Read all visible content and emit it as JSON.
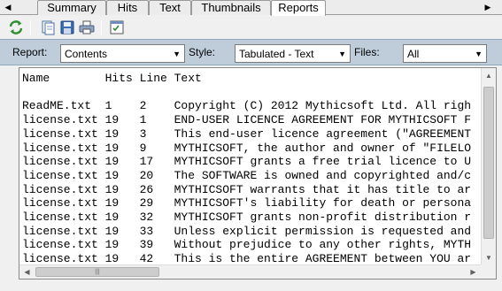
{
  "tabs": {
    "scroll_left": "◀",
    "scroll_right": "▶",
    "items": [
      {
        "label": "Summary"
      },
      {
        "label": "Hits"
      },
      {
        "label": "Text"
      },
      {
        "label": "Thumbnails"
      },
      {
        "label": "Reports"
      }
    ],
    "active": "Reports"
  },
  "toolbar": {
    "buttons": [
      "refresh-icon",
      "copy-icon",
      "save-icon",
      "print-icon",
      "report-options-icon"
    ]
  },
  "options": {
    "report_label": "Report:",
    "report_value": "Contents",
    "style_label": "Style:",
    "style_value": "Tabulated - Text",
    "files_label": "Files:",
    "files_value": "All"
  },
  "report": {
    "header": {
      "name": "Name",
      "hits": "Hits",
      "line": "Line",
      "text": "Text"
    },
    "rows": [
      {
        "name": "ReadME.txt",
        "hits": "1",
        "line": "2",
        "text": "Copyright (C) 2012 Mythicsoft Ltd. All righ"
      },
      {
        "name": "license.txt",
        "hits": "19",
        "line": "1",
        "text": "END-USER LICENCE AGREEMENT FOR MYTHICSOFT F"
      },
      {
        "name": "license.txt",
        "hits": "19",
        "line": "3",
        "text": "This end-user licence agreement (\"AGREEMENT"
      },
      {
        "name": "license.txt",
        "hits": "19",
        "line": "9",
        "text": "MYTHICSOFT, the author and owner of \"FILELO"
      },
      {
        "name": "license.txt",
        "hits": "19",
        "line": "17",
        "text": "MYTHICSOFT grants a free trial licence to U"
      },
      {
        "name": "license.txt",
        "hits": "19",
        "line": "20",
        "text": "The SOFTWARE is owned and copyrighted and/c"
      },
      {
        "name": "license.txt",
        "hits": "19",
        "line": "26",
        "text": "MYTHICSOFT warrants that it has title to ar"
      },
      {
        "name": "license.txt",
        "hits": "19",
        "line": "29",
        "text": "MYTHICSOFT's liability for death or persona"
      },
      {
        "name": "license.txt",
        "hits": "19",
        "line": "32",
        "text": "MYTHICSOFT grants non-profit distribution r"
      },
      {
        "name": "license.txt",
        "hits": "19",
        "line": "33",
        "text": "Unless explicit permission is requested and"
      },
      {
        "name": "license.txt",
        "hits": "19",
        "line": "39",
        "text": "Without prejudice to any other rights, MYTH"
      },
      {
        "name": "license.txt",
        "hits": "19",
        "line": "42",
        "text": "This is the entire AGREEMENT between YOU ar"
      }
    ]
  },
  "scrollbars": {
    "up": "▲",
    "down": "▼",
    "left": "◀",
    "right": "▶",
    "grip": "|||"
  }
}
